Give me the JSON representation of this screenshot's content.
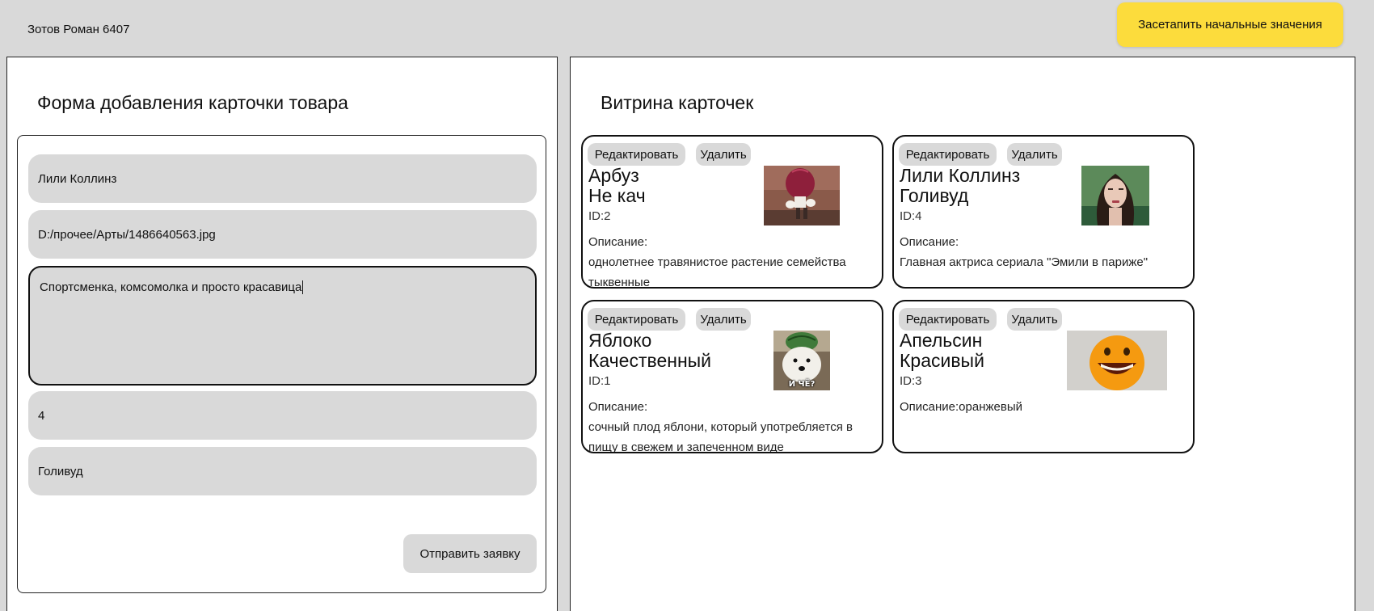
{
  "header": {
    "author": "Зотов Роман 6407",
    "reset_label": "Засетапить начальные значения"
  },
  "form_panel": {
    "title": "Форма добавления карточки товара",
    "fields": {
      "name": "Лили Коллинз",
      "image_path": "D:/прочее/Арты/1486640563.jpg",
      "description": "Спортсменка, комсомолка и просто красавица",
      "id": "4",
      "subtitle": "Голивуд"
    },
    "submit_label": "Отправить заявку"
  },
  "showcase": {
    "title": "Витрина карточек",
    "edit_label": "Редактировать",
    "delete_label": "Удалить",
    "cards": [
      {
        "name": "Арбуз",
        "subtitle": "Не кач",
        "id": "ID:2",
        "desc_label": "Описание:",
        "description": "однолетнее травянистое растение семейства тыквенные",
        "image": "muscular-watermelon-mascot"
      },
      {
        "name": "Лили Коллинз",
        "subtitle": "Голивуд",
        "id": "ID:4",
        "desc_label": "Описание:",
        "description": "Главная актриса сериала \"Эмили в париже\"",
        "image": "actress-portrait"
      },
      {
        "name": "Яблоко",
        "subtitle": "Качественный",
        "id": "ID:1",
        "desc_label": "Описание:",
        "description": "сочный плод яблони, который употребляется в пищу в свежем и запеченном виде",
        "image": "dog-with-watermelon-hat-meme",
        "meme_caption": "И ЧЁ?"
      },
      {
        "name": "Апельсин",
        "subtitle": "Красивый",
        "id": "ID:3",
        "desc_inline": "Описание:оранжевый",
        "image": "smiling-orange-face"
      }
    ]
  },
  "colors": {
    "background": "#d9d9d9",
    "accent_yellow": "#fcdc3c",
    "panel": "#ffffff",
    "input_bg": "#d9d9d9"
  }
}
